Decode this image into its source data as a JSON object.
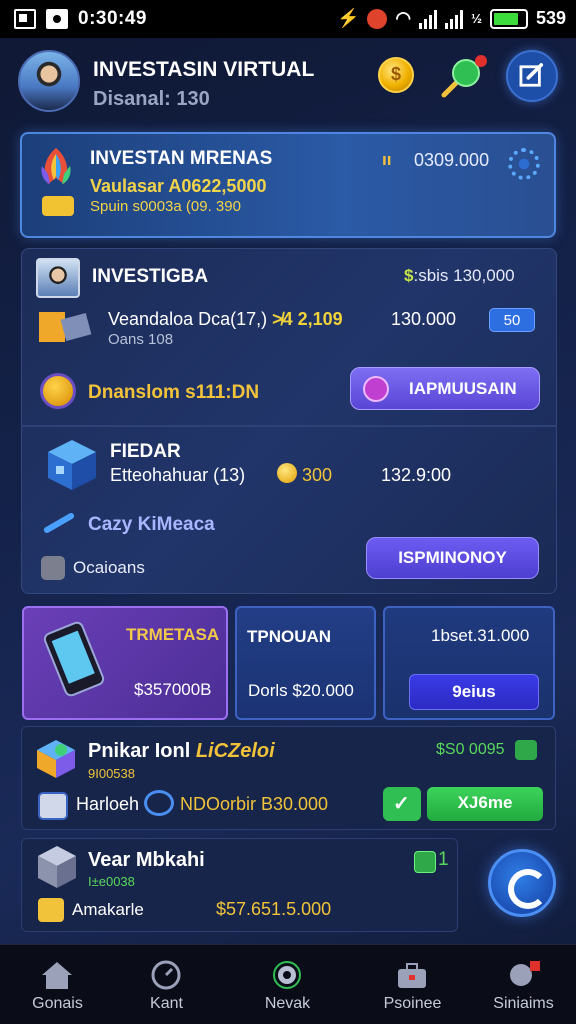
{
  "status_bar": {
    "time": "0:30:49",
    "battery": "539",
    "signal_label": "½"
  },
  "header": {
    "title": "INVESTASIN VIRTUAL",
    "subtitle": "Disanal: 130",
    "icons": [
      "coin-icon",
      "pin-icon",
      "edit-icon"
    ]
  },
  "top_card": {
    "title": "INVESTAN MRENAS",
    "line2": "Vaulasar A0622,5000",
    "line3": "Spuin s0003a (09. 390",
    "badge": "ıı",
    "value": "0309.000",
    "icon": "gear-icon"
  },
  "panel": {
    "title": "INVESTIGBA",
    "stat_prefix": "$",
    "stat": ":sbis 130,000",
    "row1": {
      "label": "Veandaloa Dca(17,)",
      "highlight": "≯4 2,109",
      "sub": "Oans 108",
      "number": "130.000",
      "chip": "50"
    },
    "gold_label": "Dnanslom s111:DN",
    "purple_button": "IAPMUUSAIN",
    "sub_section": {
      "title": "FIEDAR",
      "row_label": "Etteohahuar (13)",
      "coin_value": "300",
      "number": "132.9:00",
      "italic_label": "Cazy KiMeaca",
      "small_label": "Ocaioans",
      "button": "ISPMINONOY"
    }
  },
  "tiles": [
    {
      "title": "TRMETASA",
      "value": "$357000B"
    },
    {
      "title": "TPNOUAN",
      "value": "Dorls $20.000"
    },
    {
      "title": "1bset.31.000",
      "button": "9eius"
    }
  ],
  "card5": {
    "title": "Pnikar Ionl",
    "title_accent": "LiCZeloi",
    "sub": "9I00538",
    "right_value": "$S0 0095",
    "name": "Harloeh",
    "value": "NDOorbir B30.000",
    "button": "XJ6me"
  },
  "card6": {
    "title": "Vear Mbkahi",
    "sub": "I±e0038",
    "count": "1",
    "name": "Amakarle",
    "value": "$57.651.5.000"
  },
  "nav": [
    {
      "label": "Gonais",
      "icon": "home-icon"
    },
    {
      "label": "Kant",
      "icon": "clock-icon"
    },
    {
      "label": "Nevak",
      "icon": "camera-icon"
    },
    {
      "label": "Psoinee",
      "icon": "briefcase-icon"
    },
    {
      "label": "Siniaims",
      "icon": "chat-icon"
    }
  ],
  "colors": {
    "background": "#14224a",
    "accent_gold": "#f0c33a",
    "accent_green": "#58d85a",
    "accent_purple": "#6d5cf2",
    "accent_blue": "#2d6fe0"
  }
}
